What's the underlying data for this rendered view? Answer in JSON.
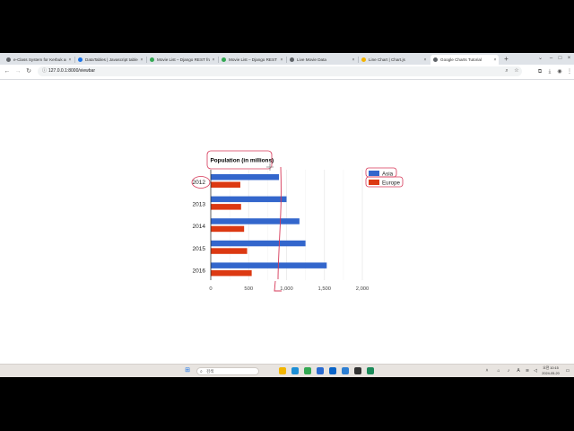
{
  "browser": {
    "tabs": [
      {
        "label": "e-Class System for Kerbuk and Us...",
        "color": "#5f6368",
        "active": false
      },
      {
        "label": "DataTables | Javascript table libr...",
        "color": "#1a73e8",
        "active": false
      },
      {
        "label": "Movie List – Django REST frame...",
        "color": "#34a853",
        "active": false
      },
      {
        "label": "Movie List – Django REST frame...",
        "color": "#34a853",
        "active": false
      },
      {
        "label": "Live Movie Data",
        "color": "#5f6368",
        "active": false
      },
      {
        "label": "Line Chart | Chart.js",
        "color": "#f4b400",
        "active": false
      },
      {
        "label": "Google Charts Tutorial",
        "color": "#5f6368",
        "active": true
      }
    ],
    "new_tab_icon": "plus-icon",
    "url": "127.0.0.1:8000/viewbar"
  },
  "taskbar": {
    "search_placeholder": "검색",
    "apps": [
      {
        "name": "file-explorer-icon",
        "color": "#f2b500"
      },
      {
        "name": "edge-icon",
        "color": "#1d8fd6"
      },
      {
        "name": "chrome-icon",
        "color": "#34a853"
      },
      {
        "name": "store-icon",
        "color": "#2a6bd1"
      },
      {
        "name": "mail-icon",
        "color": "#0a64c8"
      },
      {
        "name": "vscode-icon",
        "color": "#2d7fd3"
      },
      {
        "name": "terminal-icon",
        "color": "#333333"
      },
      {
        "name": "pycharm-icon",
        "color": "#1b8a5a"
      }
    ],
    "clock": {
      "time": "오전 10:15",
      "date": "2024-05-20"
    }
  },
  "chart_data": {
    "type": "bar",
    "orientation": "horizontal",
    "title": "Population (in millions)",
    "categories": [
      "2012",
      "2013",
      "2014",
      "2015",
      "2016"
    ],
    "series": [
      {
        "name": "Asia",
        "color": "#3366cc",
        "values": [
          900,
          1000,
          1170,
          1250,
          1530
        ]
      },
      {
        "name": "Europe",
        "color": "#dc3912",
        "values": [
          390,
          400,
          440,
          480,
          540
        ]
      }
    ],
    "x_ticks": [
      "0",
      "500",
      "1,000",
      "1,500",
      "2,000"
    ],
    "xlim": [
      0,
      2000
    ],
    "grid": true,
    "legend_position": "right",
    "annotation_color": "#d63757"
  }
}
